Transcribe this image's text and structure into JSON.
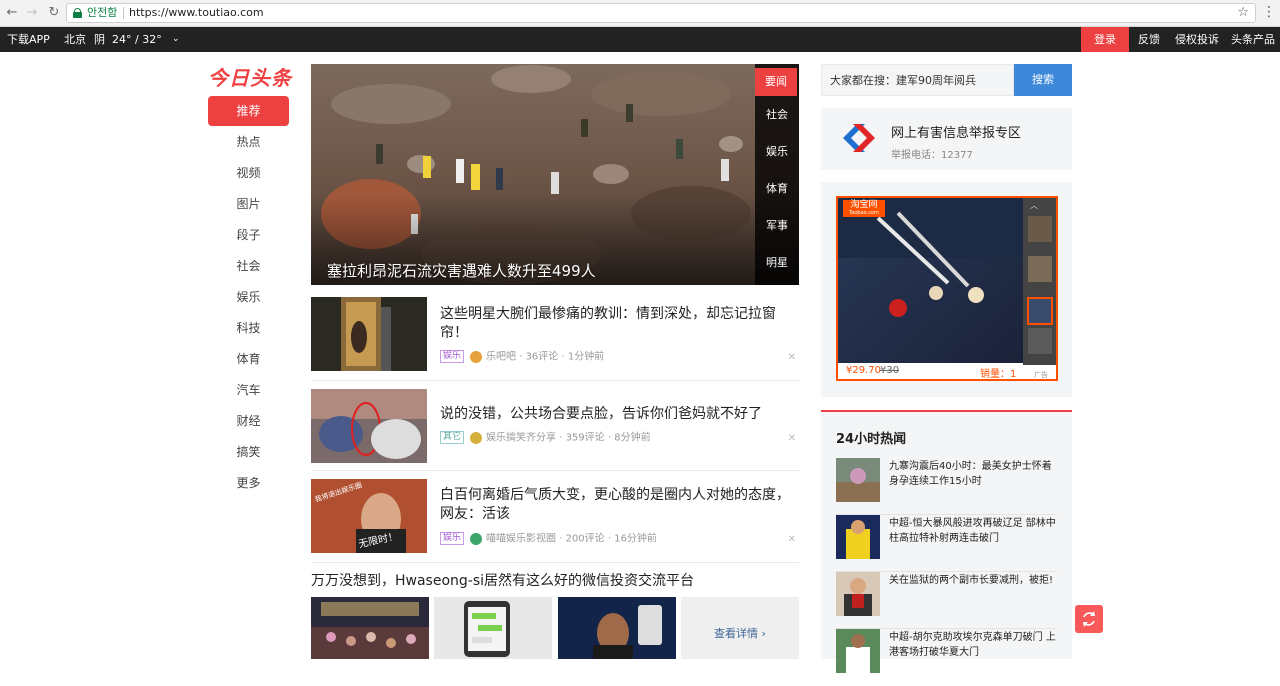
{
  "browser": {
    "secure_label": "안전함",
    "url": "https://www.toutiao.com",
    "star_glyph": "☆",
    "menu_glyph": "⋮"
  },
  "topbar": {
    "download": "下载APP",
    "city": "北京",
    "weather": "阴",
    "temp": "24° / 32°",
    "caret": "⌄",
    "login": "登录",
    "feedback": "反馈",
    "complaint": "侵权投诉",
    "products": "头条产品"
  },
  "logo": "今日头条",
  "channels": [
    "推荐",
    "热点",
    "视频",
    "图片",
    "段子",
    "社会",
    "娱乐",
    "科技",
    "体育",
    "汽车",
    "财经",
    "搞笑",
    "更多"
  ],
  "hero": {
    "title": "塞拉利昂泥石流灾害遇难人数升至499人",
    "tabs": [
      "要闻",
      "社会",
      "娱乐",
      "体育",
      "军事",
      "明星"
    ]
  },
  "feed": [
    {
      "title": "这些明星大腕们最惨痛的教训：情到深处，却忘记拉窗帘！",
      "tag": "娱乐",
      "source": "乐吧吧",
      "comments": "36评论",
      "time": "1分钟前"
    },
    {
      "title": "说的没错，公共场合要点脸，告诉你们爸妈就不好了",
      "tag": "其它",
      "source": "娱乐搞笑齐分享",
      "comments": "359评论",
      "time": "8分钟前"
    },
    {
      "title": "白百何离婚后气质大变，更心酸的是圈内人对她的态度，网友：活该",
      "tag": "娱乐",
      "source": "喵喵娱乐影视圈",
      "comments": "200评论",
      "time": "16分钟前",
      "thumb_overlay_1": "我将退出娱乐圈",
      "thumb_overlay_2": "无限时！"
    }
  ],
  "gallery_article": {
    "title": "万万没想到，Hwaseong-si居然有这么好的微信投资交流平台",
    "more": "查看详情 ›"
  },
  "search": {
    "value": "大家都在搜：建军90周年阅兵",
    "button": "搜索"
  },
  "report": {
    "title": "网上有害信息举报专区",
    "phone": "举报电话：12377"
  },
  "ad": {
    "brand": "淘宝网",
    "brand_sub": "Taobao.com",
    "price": "¥29.70",
    "old_price": "¥30",
    "sales": "销量：1",
    "label": "广告"
  },
  "hot": {
    "title": "24小时热闻",
    "items": [
      "九寨沟震后40小时：最美女护士怀着身孕连续工作15小时",
      "中超-恒大暴风般进攻再破辽足 郜林中柱高拉特补射两连击破门",
      "关在监狱的两个副市长要减刑，被拒!",
      "中超-胡尔克助攻埃尔克森单刀破门 上港客场打破华夏大门"
    ]
  },
  "colors": {
    "accent": "#ed4040",
    "search_blue": "#3e88d9",
    "taobao_orange": "#ff5000"
  }
}
